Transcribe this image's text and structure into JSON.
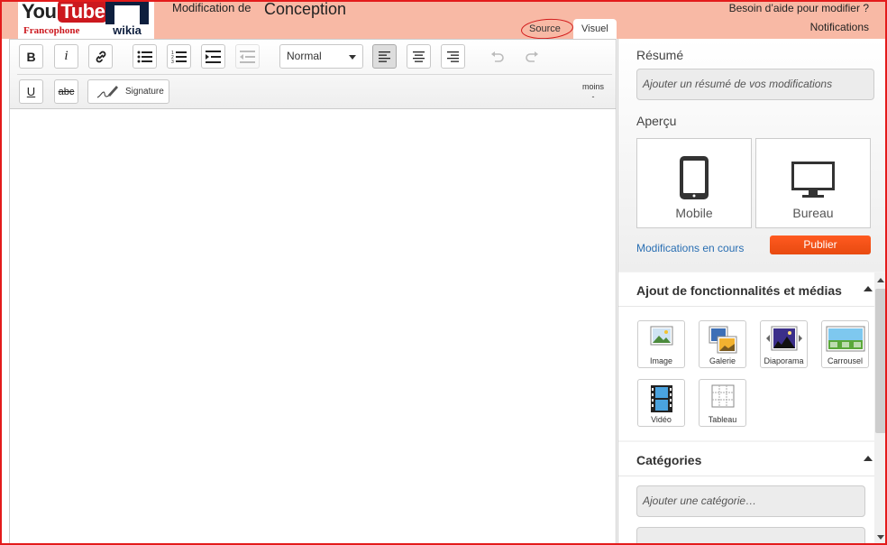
{
  "header": {
    "logo": {
      "you": "You",
      "tube": "Tube",
      "francophone": "Francophone",
      "wikia": "wikia"
    },
    "edit_prefix": "Modification de",
    "page_title": "Conception",
    "help_link": "Besoin d’aide pour modifier ?",
    "notifications": "Notifications",
    "tabs": [
      {
        "label": "Source"
      },
      {
        "label": "Visuel",
        "active": true
      }
    ]
  },
  "toolbar": {
    "bold": "B",
    "italic": "i",
    "format_select": "Normal",
    "underline": "U",
    "strikethrough": "abc",
    "signature": "Signature",
    "moins": "moins",
    "moins_value": "-"
  },
  "sidebar": {
    "summary": {
      "heading": "Résumé",
      "placeholder": "Ajouter un résumé de vos modifications"
    },
    "preview": {
      "heading": "Aperçu",
      "mobile": "Mobile",
      "desktop": "Bureau"
    },
    "current_changes": "Modifications en cours",
    "publish": "Publier",
    "media_section": {
      "title": "Ajout de fonctionnalités et médias",
      "items": [
        {
          "label": "Image",
          "icon": "image-icon"
        },
        {
          "label": "Galerie",
          "icon": "gallery-icon"
        },
        {
          "label": "Diaporama",
          "icon": "slideshow-icon"
        },
        {
          "label": "Carrousel",
          "icon": "carousel-icon"
        },
        {
          "label": "Vidéo",
          "icon": "video-icon"
        },
        {
          "label": "Tableau",
          "icon": "table-icon"
        }
      ]
    },
    "categories": {
      "title": "Catégories",
      "placeholder": "Ajouter une catégorie…"
    }
  },
  "colors": {
    "header_bg": "#f8b9a5",
    "publish_bg": "#f2541b",
    "frame_border": "#e31b1b",
    "link": "#2a6fb3"
  }
}
